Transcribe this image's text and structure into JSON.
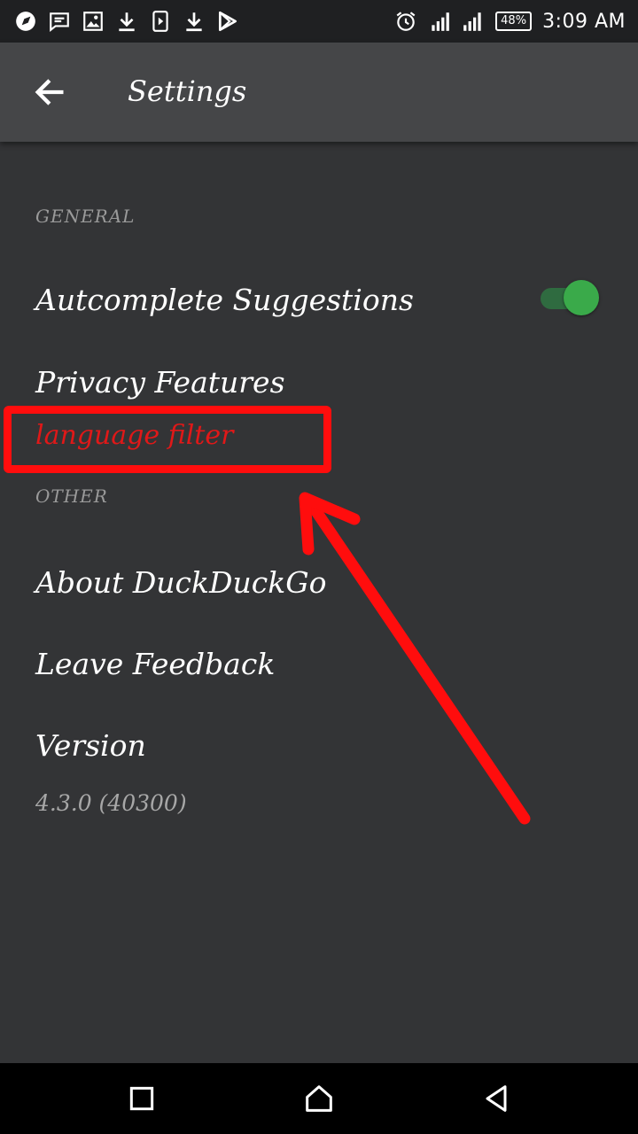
{
  "status_bar": {
    "left_icons": [
      "compass-icon",
      "message-icon",
      "image-icon",
      "download-icon",
      "video-icon",
      "download-icon",
      "play-store-icon"
    ],
    "right_icons": [
      "alarm-icon",
      "signal-icon",
      "signal-icon"
    ],
    "battery": "48%",
    "time": "3:09 AM"
  },
  "app_bar": {
    "back_icon": "arrow-left-icon",
    "title": "Settings"
  },
  "sections": {
    "general": "GENERAL",
    "other": "OTHER"
  },
  "items": {
    "autocomplete": {
      "title": "Autcomplete Suggestions",
      "toggle_on": true
    },
    "privacy": {
      "title": "Privacy Features"
    },
    "language_filter": {
      "title": "language filter"
    },
    "about": {
      "title": "About DuckDuckGo"
    },
    "feedback": {
      "title": "Leave Feedback"
    },
    "version": {
      "title": "Version",
      "summary": "4.3.0 (40300)"
    }
  },
  "colors": {
    "background": "#333436",
    "app_bar": "#454648",
    "toggle_on": "#3aaa4a",
    "annotation_red": "#ff0d0d"
  },
  "nav_bar": {
    "icons": [
      "recents-square-icon",
      "home-icon",
      "back-triangle-icon"
    ]
  }
}
